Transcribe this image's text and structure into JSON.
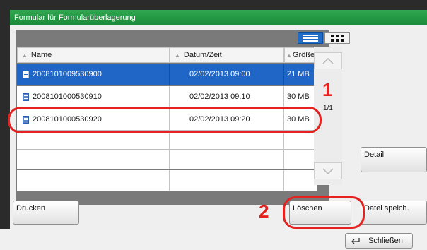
{
  "panel": {
    "title": "Formular für Formularüberlagerung"
  },
  "columns": {
    "name": "Name",
    "date": "Datum/Zeit",
    "size": "Größe"
  },
  "rows": [
    {
      "name": "2008101009530900",
      "date": "02/02/2013 09:00",
      "size": "21  MB",
      "selected": true
    },
    {
      "name": "2008101000530910",
      "date": "02/02/2013 09:10",
      "size": "30  MB",
      "selected": false
    },
    {
      "name": "2008101000530920",
      "date": "02/02/2013 09:20",
      "size": "30  MB",
      "selected": false
    }
  ],
  "pagination": {
    "page": "1/1"
  },
  "buttons": {
    "detail": "Detail",
    "print": "Drucken",
    "delete": "Löschen",
    "save_file": "Datei speich.",
    "close": "Schließen"
  },
  "callouts": {
    "one": "1",
    "two": "2"
  },
  "colors": {
    "title_green": "#1b8a3a",
    "selection_blue": "#1f66c6",
    "callout_red": "#e5221f"
  }
}
